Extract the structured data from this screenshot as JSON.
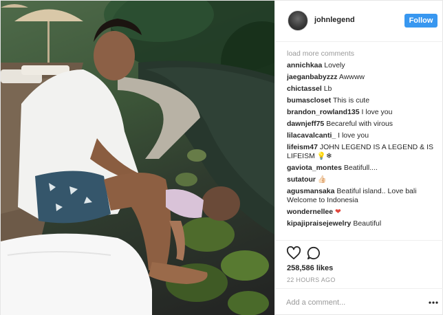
{
  "post": {
    "username": "johnlegend",
    "follow_label": "Follow",
    "load_more": "load more comments",
    "comments": [
      {
        "user": "annichkaa",
        "text": "Lovely"
      },
      {
        "user": "jaeganbabyzzz",
        "text": "Awwww"
      },
      {
        "user": "chictassel",
        "text": "Lb"
      },
      {
        "user": "bumascloset",
        "text": "This is cute"
      },
      {
        "user": "brandon_rowland135",
        "text": "I love you"
      },
      {
        "user": "dawnjeff75",
        "text": "Becareful with virous"
      },
      {
        "user": "lilacavalcanti_",
        "text": "I love you"
      },
      {
        "user": "lifeism47",
        "text": "JOHN LEGEND IS A LEGEND & IS LIFEISM 💡❄"
      },
      {
        "user": "gaviota_montes",
        "text": "Beatifull...."
      },
      {
        "user": "sutatour",
        "text": "👍🏻"
      },
      {
        "user": "agusmansaka",
        "text": "Beatiful island.. Love bali Welcome to Indonesia"
      },
      {
        "user": "wondernellee",
        "text": "❤"
      },
      {
        "user": "kipajipraisejewelry",
        "text": "Beautiful"
      }
    ],
    "likes": "258,586 likes",
    "time": "22 HOURS AGO",
    "add_comment_placeholder": "Add a comment...",
    "icons": {
      "like": "heart-icon",
      "comment": "comment-icon",
      "more": "more-options-icon"
    },
    "colors": {
      "follow_button": "#3897f0",
      "username_text": "#262626",
      "muted_text": "#999999"
    }
  }
}
